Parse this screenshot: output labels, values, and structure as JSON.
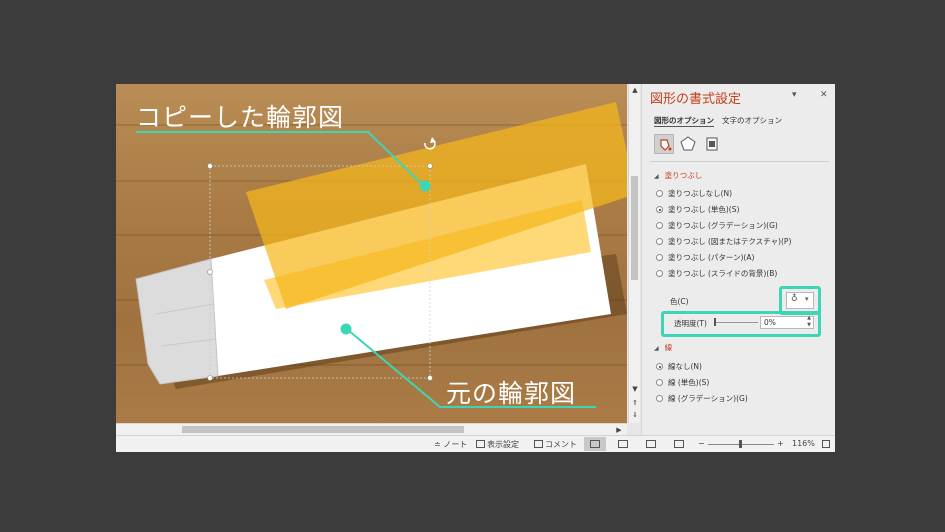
{
  "callouts": {
    "copy_label": "コピーした輪郭図",
    "original_label": "元の輪郭図"
  },
  "pane": {
    "title": "図形の書式設定",
    "menu_glyph": "▾",
    "close_glyph": "✕",
    "tabs": [
      {
        "label": "図形のオプション",
        "active": true
      },
      {
        "label": "文字のオプション",
        "active": false
      }
    ],
    "icon_tabs": [
      "fill-line-icon",
      "effects-pentagon-icon",
      "size-properties-icon"
    ],
    "fill_section": {
      "heading": "塗りつぶし",
      "options": [
        {
          "label": "塗りつぶしなし(N)",
          "selected": false
        },
        {
          "label": "塗りつぶし (単色)(S)",
          "selected": true
        },
        {
          "label": "塗りつぶし (グラデーション)(G)",
          "selected": false
        },
        {
          "label": "塗りつぶし (図またはテクスチャ)(P)",
          "selected": false
        },
        {
          "label": "塗りつぶし (パターン)(A)",
          "selected": false
        },
        {
          "label": "塗りつぶし (スライドの背景)(B)",
          "selected": false
        }
      ],
      "color_label": "色(C)",
      "transparency_label": "透明度(T)",
      "transparency_value": "0%",
      "transparency": 0
    },
    "line_section": {
      "heading": "線",
      "options": [
        {
          "label": "線なし(N)",
          "selected": true
        },
        {
          "label": "線 (単色)(S)",
          "selected": false
        },
        {
          "label": "線 (グラデーション)(G)",
          "selected": false
        }
      ]
    }
  },
  "statusbar": {
    "notes": "ノート",
    "display_settings": "表示設定",
    "comments": "コメント",
    "zoom_minus": "−",
    "zoom_plus": "+",
    "zoom": "116%"
  },
  "colors": {
    "highlight": "#3cd6b6",
    "accent": "#c43e1c",
    "copy_shape": "#f5b71c",
    "original_shape": "#ffffff"
  }
}
